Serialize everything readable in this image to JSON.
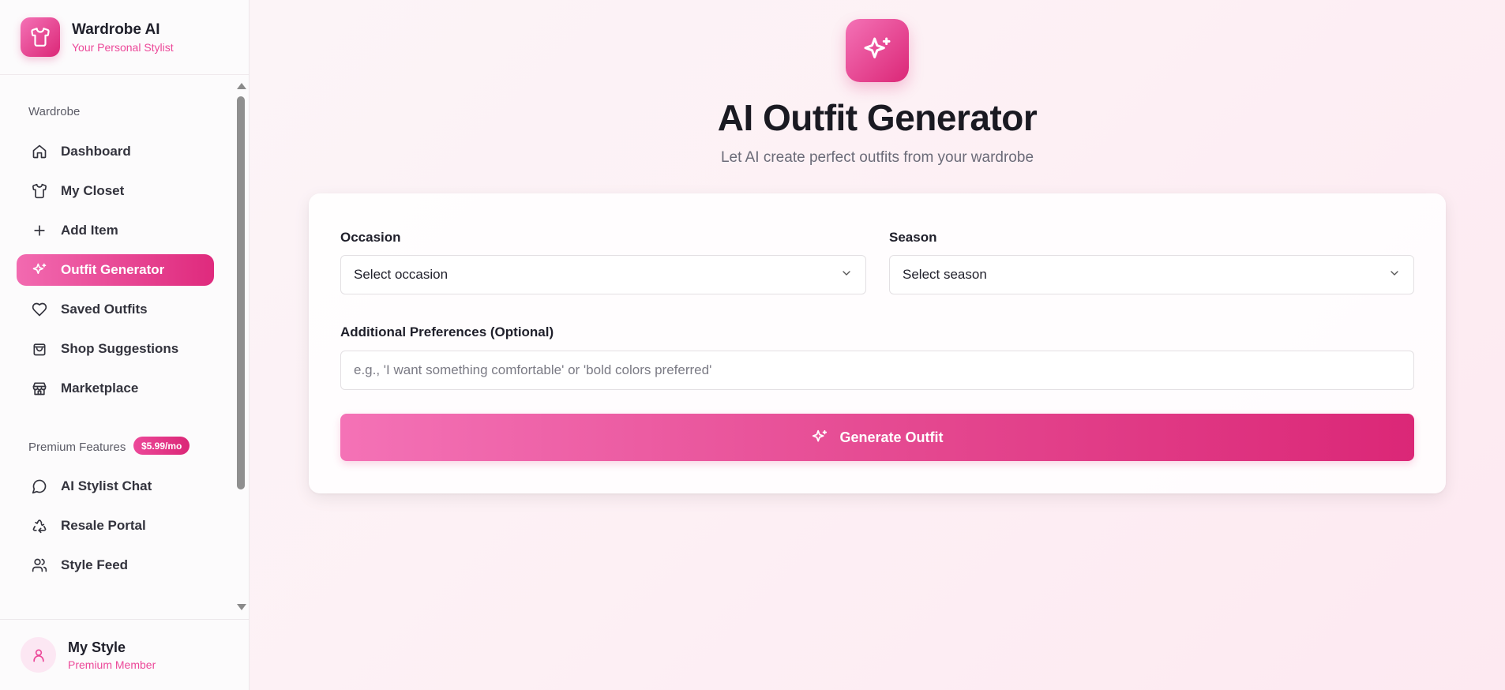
{
  "app": {
    "title": "Wardrobe AI",
    "subtitle": "Your Personal Stylist",
    "logo_icon": "shirt-icon"
  },
  "sidebar": {
    "wardrobe_section": "Wardrobe",
    "items": [
      {
        "label": "Dashboard",
        "icon": "home-icon",
        "active": false
      },
      {
        "label": "My Closet",
        "icon": "shirt-icon",
        "active": false
      },
      {
        "label": "Add Item",
        "icon": "plus-icon",
        "active": false
      },
      {
        "label": "Outfit Generator",
        "icon": "sparkles-icon",
        "active": true
      },
      {
        "label": "Saved Outfits",
        "icon": "heart-icon",
        "active": false
      },
      {
        "label": "Shop Suggestions",
        "icon": "shopping-bag-icon",
        "active": false
      },
      {
        "label": "Marketplace",
        "icon": "store-icon",
        "active": false
      }
    ],
    "premium_section": "Premium Features",
    "premium_badge": "$5.99/mo",
    "premium_items": [
      {
        "label": "AI Stylist Chat",
        "icon": "chat-bubble-icon"
      },
      {
        "label": "Resale Portal",
        "icon": "recycle-icon"
      },
      {
        "label": "Style Feed",
        "icon": "users-icon"
      }
    ]
  },
  "user": {
    "name": "My Style",
    "role": "Premium Member",
    "avatar_icon": "user-icon"
  },
  "main": {
    "hero_icon": "sparkles-icon",
    "title": "AI Outfit Generator",
    "subtitle": "Let AI create perfect outfits from your wardrobe",
    "form": {
      "occasion_label": "Occasion",
      "occasion_value": "Select occasion",
      "season_label": "Season",
      "season_value": "Select season",
      "preferences_label": "Additional Preferences (Optional)",
      "preferences_placeholder": "e.g., 'I want something comfortable' or 'bold colors preferred'",
      "preferences_value": "",
      "generate_label": "Generate Outfit"
    }
  },
  "colors": {
    "accent": "#ec4899",
    "accent_dark": "#db2777",
    "accent_light": "#f472b6"
  }
}
